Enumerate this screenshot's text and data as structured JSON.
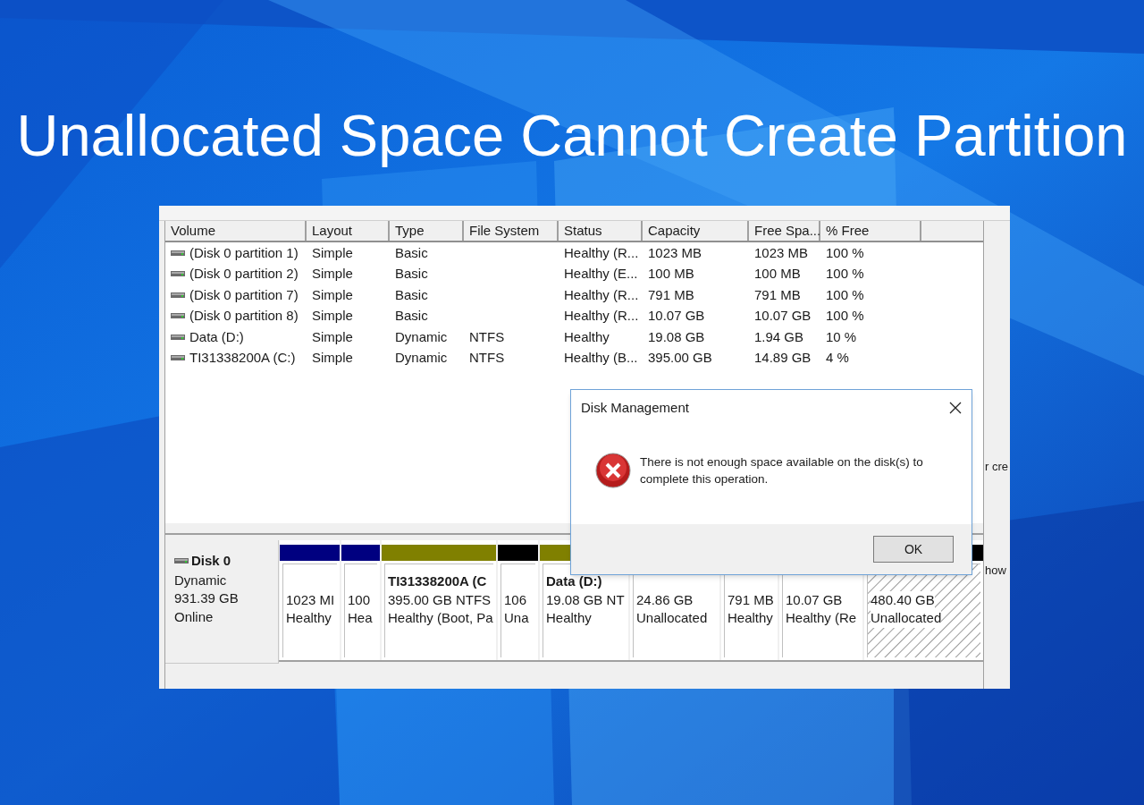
{
  "headline": "Unallocated Space Cannot Create Partition",
  "volume_table": {
    "columns": [
      "Volume",
      "Layout",
      "Type",
      "File System",
      "Status",
      "Capacity",
      "Free Spa...",
      "% Free"
    ],
    "rows": [
      [
        "(Disk 0 partition 1)",
        "Simple",
        "Basic",
        "",
        "Healthy (R...",
        "1023 MB",
        "1023 MB",
        "100 %"
      ],
      [
        "(Disk 0 partition 2)",
        "Simple",
        "Basic",
        "",
        "Healthy (E...",
        "100 MB",
        "100 MB",
        "100 %"
      ],
      [
        "(Disk 0 partition 7)",
        "Simple",
        "Basic",
        "",
        "Healthy (R...",
        "791 MB",
        "791 MB",
        "100 %"
      ],
      [
        "(Disk 0 partition 8)",
        "Simple",
        "Basic",
        "",
        "Healthy (R...",
        "10.07 GB",
        "10.07 GB",
        "100 %"
      ],
      [
        "Data (D:)",
        "Simple",
        "Dynamic",
        "NTFS",
        "Healthy",
        "19.08 GB",
        "1.94 GB",
        "10 %"
      ],
      [
        "TI31338200A (C:)",
        "Simple",
        "Dynamic",
        "NTFS",
        "Healthy (B...",
        "395.00 GB",
        "14.89 GB",
        "4 %"
      ]
    ]
  },
  "disk": {
    "name": "Disk 0",
    "lines": [
      "Dynamic",
      "931.39 GB",
      "Online"
    ],
    "partitions": [
      {
        "color": "#000080",
        "hatched": false,
        "lines": [
          "1023 MI",
          "Healthy"
        ]
      },
      {
        "color": "#000080",
        "hatched": false,
        "lines": [
          "100",
          "Hea"
        ]
      },
      {
        "color": "#808000",
        "hatched": false,
        "title": "TI31338200A  (C",
        "lines": [
          "395.00 GB NTFS",
          "Healthy (Boot, Pa"
        ]
      },
      {
        "color": "#000000",
        "hatched": false,
        "lines": [
          "106",
          "Una"
        ]
      },
      {
        "color": "#808000",
        "hatched": false,
        "title": "Data  (D:)",
        "lines": [
          "19.08 GB NT",
          "Healthy"
        ]
      },
      {
        "hatched": false,
        "lines": [
          "24.86 GB",
          "Unallocated"
        ]
      },
      {
        "hatched": false,
        "lines": [
          "791 MB",
          "Healthy"
        ]
      },
      {
        "hatched": false,
        "lines": [
          "10.07 GB",
          "Healthy (Re"
        ]
      },
      {
        "color": "#000000",
        "hatched": true,
        "lines": [
          "480.40 GB",
          "Unallocated"
        ]
      }
    ]
  },
  "side_fragments": [
    "r cre",
    "how"
  ],
  "dialog": {
    "title": "Disk Management",
    "message": "There is not enough space available on the disk(s) to complete this operation.",
    "button": "OK"
  }
}
